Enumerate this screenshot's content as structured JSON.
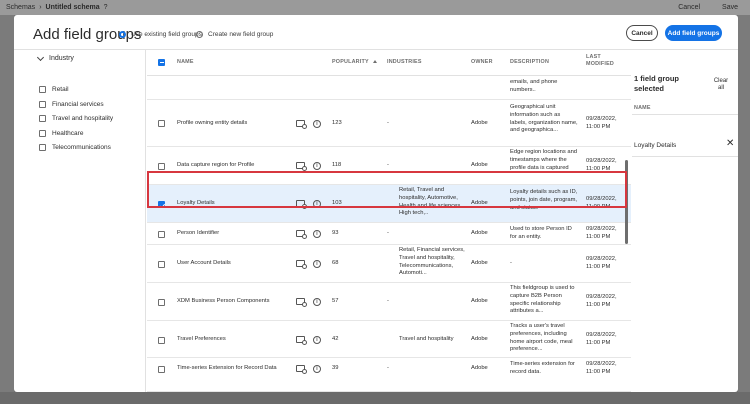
{
  "background": {
    "breadcrumb_root": "Schemas",
    "breadcrumb_sep": "›",
    "schema_name": "Untitled schema",
    "help": "?",
    "cancel": "Cancel",
    "save": "Save"
  },
  "modal": {
    "title": "Add field groups",
    "radio_existing": "Use existing field groups",
    "radio_new": "Create new field group",
    "cancel_label": "Cancel",
    "add_label": "Add field groups"
  },
  "filter": {
    "heading": "Industry",
    "items": [
      "Retail",
      "Financial services",
      "Travel and hospitality",
      "Healthcare",
      "Telecommunications"
    ]
  },
  "table": {
    "columns": {
      "name": "NAME",
      "popularity": "POPULARITY",
      "industries": "INDUSTRIES",
      "owner": "OWNER",
      "description": "DESCRIPTION",
      "last_modified": "LAST MODIFIED"
    },
    "rows": [
      {
        "name": "",
        "popularity": "",
        "industries": "",
        "owner": "",
        "description": "emails, and phone numbers..",
        "modified": "",
        "checked": false
      },
      {
        "name": "Profile owning entity details",
        "popularity": "123",
        "industries": "-",
        "owner": "Adobe",
        "description": "Geographical unit information such as labels, organization name, and geographica...",
        "modified": "09/28/2022, 11:00 PM",
        "checked": false
      },
      {
        "name": "Data capture region for Profile",
        "popularity": "118",
        "industries": "-",
        "owner": "Adobe",
        "description": "Edge region locations and timestamps where the profile data is captured",
        "modified": "09/28/2022, 11:00 PM",
        "checked": false
      },
      {
        "name": "Loyalty Details",
        "popularity": "103",
        "industries": "Retail, Travel and hospitality, Automotive, Health and life sciences, High tech,..",
        "owner": "Adobe",
        "description": "Loyalty details such as ID, points, join date, program, and status.",
        "modified": "09/28/2022, 11:00 PM",
        "checked": true
      },
      {
        "name": "Person Identifier",
        "popularity": "93",
        "industries": "-",
        "owner": "Adobe",
        "description": "Used to store Person ID for an entity.",
        "modified": "09/28/2022, 11:00 PM",
        "checked": false
      },
      {
        "name": "User Account Details",
        "popularity": "68",
        "industries": "Retail, Financial services, Travel and hospitality, Telecommunications, Automoti...",
        "owner": "Adobe",
        "description": "-",
        "modified": "09/28/2022, 11:00 PM",
        "checked": false
      },
      {
        "name": "XDM Business Person Components",
        "popularity": "57",
        "industries": "-",
        "owner": "Adobe",
        "description": "This fieldgroup is used to capture B2B Person specific relationship attributes a...",
        "modified": "09/28/2022, 11:00 PM",
        "checked": false
      },
      {
        "name": "Travel Preferences",
        "popularity": "42",
        "industries": "Travel and hospitality",
        "owner": "Adobe",
        "description": "Tracks a user's travel preferences, including home airport code, meal preference...",
        "modified": "09/28/2022, 11:00 PM",
        "checked": false
      },
      {
        "name": "Time-series Extension for Record Data",
        "popularity": "39",
        "industries": "-",
        "owner": "Adobe",
        "description": "Time-series extension for record data.",
        "modified": "09/28/2022, 11:00 PM",
        "checked": false
      }
    ]
  },
  "panel": {
    "title": "1 field group selected",
    "clear_all": "Clear all",
    "name_header": "NAME",
    "selected_item": "Loyalty Details",
    "remove": "✕"
  },
  "colors": {
    "accent": "#1473e6",
    "highlight_border": "#d7373f",
    "selected_row": "#e5f0fc"
  }
}
